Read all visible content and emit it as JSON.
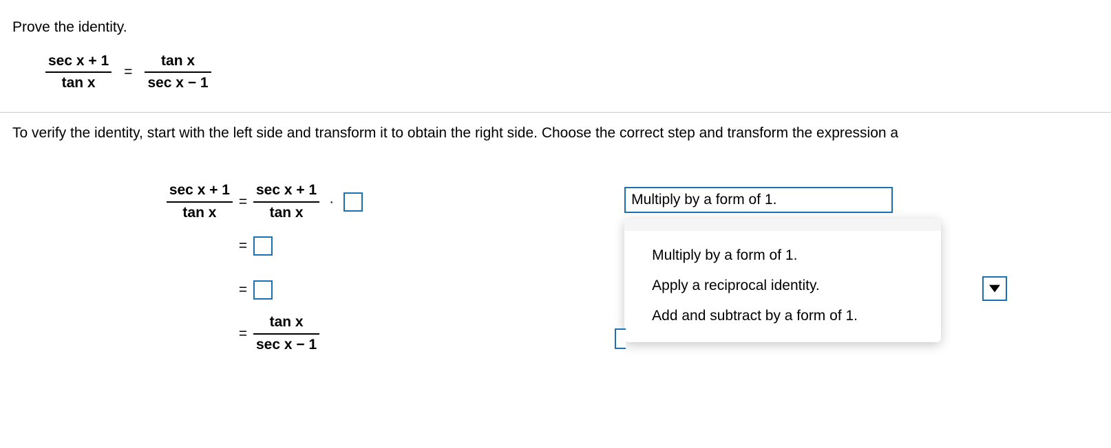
{
  "instruction": "Prove the identity.",
  "identity": {
    "left_num": "sec x + 1",
    "left_den": "tan x",
    "right_num": "tan x",
    "right_den": "sec x − 1"
  },
  "guidance": "To verify the identity, start with the left side and transform it to obtain the right side. Choose the correct step and transform the expression a",
  "steps": {
    "start_num": "sec x + 1",
    "start_den": "tan x",
    "line1_rhs_num": "sec x + 1",
    "line1_rhs_den": "tan x",
    "final_num": "tan x",
    "final_den": "sec x − 1"
  },
  "equals": "=",
  "dropdown": {
    "selected": "Multiply by a form of 1.",
    "options": [
      "Multiply by a form of 1.",
      "Apply a reciprocal identity.",
      "Add and subtract by a form of 1."
    ]
  }
}
